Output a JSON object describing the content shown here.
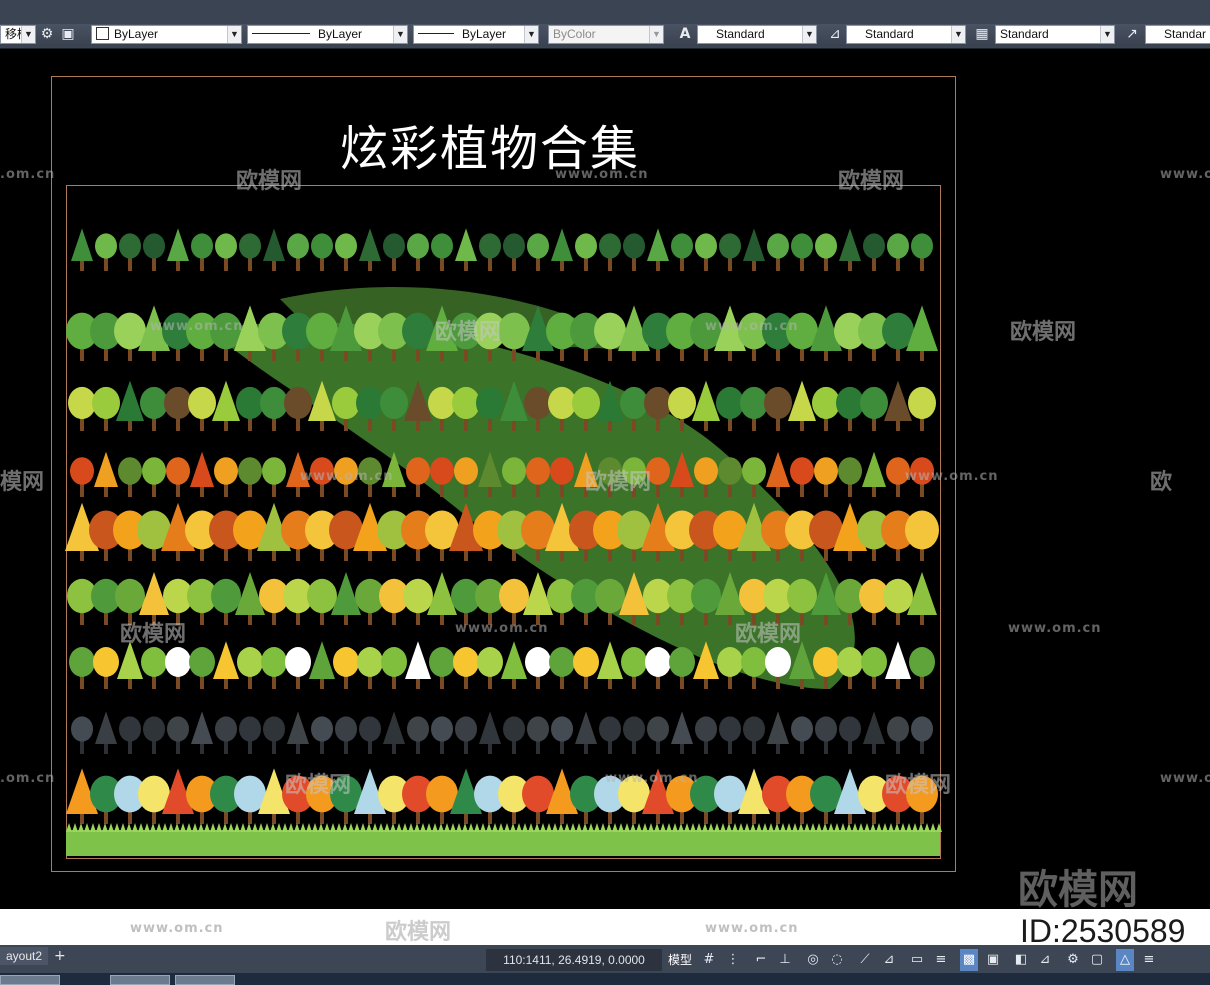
{
  "toolbar": {
    "layer_partial": "移植",
    "color_combo": "ByLayer",
    "linetype_combo": "ByLayer",
    "lineweight_combo": "ByLayer",
    "plotstyle_combo": "ByColor",
    "textstyle_combo": "Standard",
    "dimstyle_combo": "Standard",
    "tablestyle_combo": "Standard",
    "multileader_combo": "Standar"
  },
  "drawing": {
    "title": "炫彩植物合集",
    "colors": {
      "frame": "#b07a58",
      "background": "#000000",
      "grass": "#7fc24a",
      "swoosh": "#5aa43c"
    }
  },
  "watermarks": {
    "brand": "欧模网",
    "url": "www.om.cn",
    "url_partial": ".om.cn",
    "brand_partial_left": "模网",
    "brand_partial_right": "欧"
  },
  "footer": {
    "id_label": "ID:2530589"
  },
  "statusbar": {
    "layout_tab": "ayout2",
    "add_tab": "+",
    "coordinates": "110:1411, 26.4919, 0.0000",
    "model_label": "模型"
  },
  "icons": {
    "toolbar": [
      "gear-icon",
      "layer-icon",
      "text-style-icon",
      "dim-style-icon",
      "table-style-icon",
      "multileader-icon"
    ],
    "status": [
      "grid-icon",
      "snap-icon",
      "infer-icon",
      "ortho-icon",
      "polar-icon",
      "osnap-icon",
      "otrack-icon",
      "ducs-icon",
      "dyn-icon",
      "lineweight-icon",
      "transparency-icon",
      "selection-cycling-icon",
      "3d-osnap-icon",
      "annotation-icon",
      "workspace-icon",
      "isolate-icon",
      "hardware-icon",
      "customize-icon"
    ]
  }
}
